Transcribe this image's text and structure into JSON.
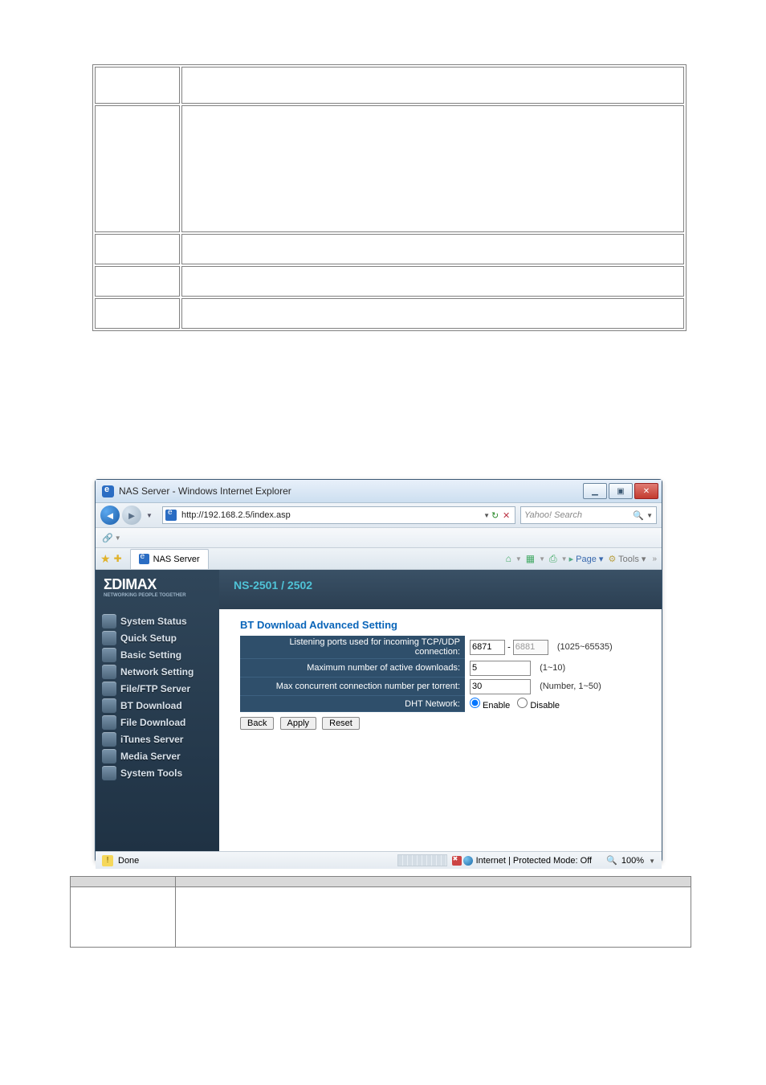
{
  "window": {
    "title": "NAS Server - Windows Internet Explorer",
    "min": "▁",
    "max": "▣",
    "close": "✕",
    "url": "http://192.168.2.5/index.asp",
    "search_placeholder": "Yahoo! Search",
    "tab_label": "NAS Server",
    "tool_home": "⌂",
    "tool_feed": "▦",
    "tool_print": "⎙",
    "tool_page": "Page",
    "tool_tools": "Tools"
  },
  "logo": {
    "brand": "ΣDIMAX",
    "tag": "NETWORKING PEOPLE TOGETHER"
  },
  "header": {
    "model": "NS-2501 / 2502"
  },
  "menu": [
    "System Status",
    "Quick Setup",
    "Basic Setting",
    "Network Setting",
    "File/FTP Server",
    "BT Download",
    "File Download",
    "iTunes Server",
    "Media Server",
    "System Tools"
  ],
  "page": {
    "title": "BT Download Advanced Setting",
    "rows": {
      "ports_label": "Listening ports used for incoming TCP/UDP connection:",
      "ports_from": "6871",
      "ports_to": "6881",
      "ports_hint": "(1025~65535)",
      "max_dl_label": "Maximum number of active downloads:",
      "max_dl_val": "5",
      "max_dl_hint": "(1~10)",
      "max_conn_label": "Max concurrent connection number per torrent:",
      "max_conn_val": "30",
      "max_conn_hint": "(Number, 1~50)",
      "dht_label": "DHT Network:",
      "enable": "Enable",
      "disable": "Disable"
    },
    "buttons": {
      "back": "Back",
      "apply": "Apply",
      "reset": "Reset"
    }
  },
  "status": {
    "done": "Done",
    "zone": "Internet | Protected Mode: Off",
    "zoom": "100%"
  }
}
